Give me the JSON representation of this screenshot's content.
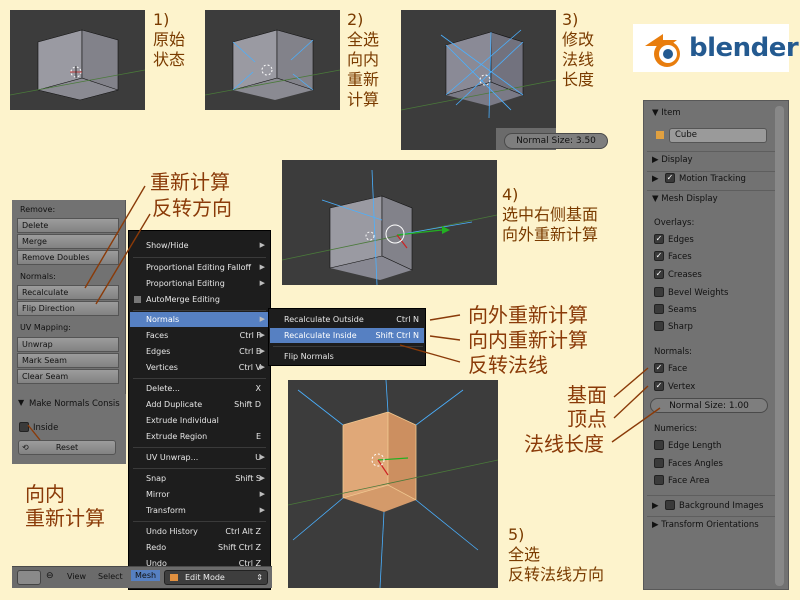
{
  "steps": {
    "s1": [
      "1)",
      "原始",
      "状态"
    ],
    "s2": [
      "2)",
      "全选",
      "向内",
      "重新",
      "计算"
    ],
    "s3": [
      "3)",
      "修改",
      "法线",
      "长度"
    ],
    "s4": [
      "4)",
      "选中右侧基面",
      "向外重新计算"
    ],
    "s5": [
      "5)",
      "全选",
      "反转法线方向"
    ]
  },
  "normal_size_field": "Normal Size: 3.50",
  "logo": {
    "word": "blender"
  },
  "annotations": {
    "recalc": "重新计算",
    "flip": "反转方向",
    "inside_1": "向内",
    "inside_2": "重新计算",
    "out": "向外重新计算",
    "in": "向内重新计算",
    "flipnormals": "反转法线",
    "face": "基面",
    "vertex": "顶点",
    "length": "法线长度"
  },
  "tool_panel": {
    "remove_label": "Remove:",
    "delete": "Delete",
    "merge": "Merge",
    "remove_doubles": "Remove Doubles",
    "normals_label": "Normals:",
    "recalculate": "Recalculate",
    "flip_direction": "Flip Direction",
    "uv_label": "UV Mapping:",
    "unwrap": "Unwrap",
    "mark_seam": "Mark Seam",
    "clear_seam": "Clear Seam",
    "operator_title": "Make Normals Consis",
    "inside": "Inside",
    "reset": "Reset"
  },
  "menu": {
    "show_hide": "Show/Hide",
    "prop_falloff": "Proportional Editing Falloff",
    "prop_edit": "Proportional Editing",
    "automerge": "AutoMerge Editing",
    "normals": "Normals",
    "faces": "Faces",
    "faces_sc": "Ctrl F",
    "edges": "Edges",
    "edges_sc": "Ctrl E",
    "vertices": "Vertices",
    "vertices_sc": "Ctrl V",
    "delete": "Delete...",
    "delete_sc": "X",
    "add_dup": "Add Duplicate",
    "add_dup_sc": "Shift D",
    "extrude_ind": "Extrude Individual",
    "extrude_reg": "Extrude Region",
    "extrude_reg_sc": "E",
    "uv_unwrap": "UV Unwrap...",
    "uv_unwrap_sc": "U",
    "snap": "Snap",
    "snap_sc": "Shift S",
    "mirror": "Mirror",
    "transform": "Transform",
    "undo_history": "Undo History",
    "undo_history_sc": "Ctrl Alt Z",
    "redo": "Redo",
    "redo_sc": "Shift Ctrl Z",
    "undo": "Undo",
    "undo_sc": "Ctrl Z"
  },
  "submenu": {
    "outside": "Recalculate Outside",
    "outside_sc": "Ctrl N",
    "inside": "Recalculate Inside",
    "inside_sc": "Shift Ctrl N",
    "flip": "Flip Normals"
  },
  "bottom_bar": {
    "view": "View",
    "select": "Select",
    "mesh": "Mesh",
    "mode": "Edit Mode"
  },
  "properties": {
    "item": "Item",
    "object_name": "Cube",
    "display": "Display",
    "motion_tracking": "Motion Tracking",
    "mesh_display": "Mesh Display",
    "overlays": "Overlays:",
    "edges": "Edges",
    "faces": "Faces",
    "creases": "Creases",
    "bevel_weights": "Bevel Weights",
    "seams": "Seams",
    "sharp": "Sharp",
    "normals": "Normals:",
    "face": "Face",
    "vertex": "Vertex",
    "normal_size": "Normal Size: 1.00",
    "numerics": "Numerics:",
    "edge_length": "Edge Length",
    "faces_angles": "Faces Angles",
    "face_area": "Face Area",
    "background_images": "Background Images",
    "transform_orientations": "Transform Orientations"
  },
  "colors": {
    "background": "#fdf3cc",
    "annotation": "#8a3a08",
    "viewport": "#3c3c3c",
    "menu_highlight": "#5680c2",
    "panel": "#727272",
    "selected_face": "#e0a070"
  }
}
